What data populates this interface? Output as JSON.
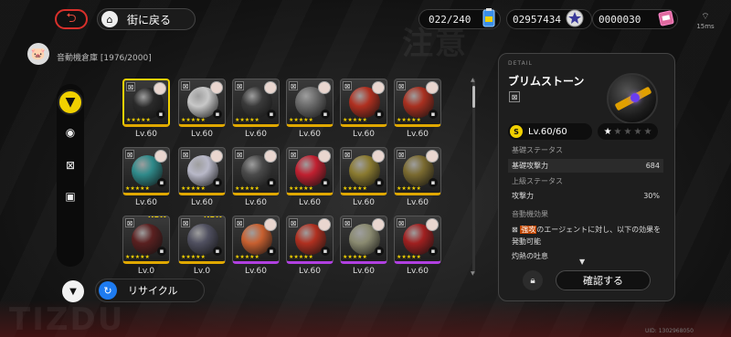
{
  "topbar": {
    "back_icon": "return-arrow-icon",
    "home_label": "街に戻る",
    "battery_count": "022/240",
    "dennies": "02957434",
    "polychrome": "0000030",
    "ping": "15ms"
  },
  "header": {
    "storage_label": "音動機倉庫 [1976/2000]"
  },
  "side_nav": {
    "items": [
      "bangboo-tab",
      "disc-tab",
      "module-tab",
      "lock-tab"
    ]
  },
  "grid": {
    "rows": [
      [
        {
          "level": "Lv.60",
          "rarity": "gold",
          "color": "#2a2a2a",
          "selected": true
        },
        {
          "level": "Lv.60",
          "rarity": "gold",
          "color": "#c8c8c8"
        },
        {
          "level": "Lv.60",
          "rarity": "gold",
          "color": "#3a3a3a"
        },
        {
          "level": "Lv.60",
          "rarity": "gold",
          "color": "#6a6a6a"
        },
        {
          "level": "Lv.60",
          "rarity": "gold",
          "color": "#b03020"
        },
        {
          "level": "Lv.60",
          "rarity": "gold",
          "color": "#a83020"
        }
      ],
      [
        {
          "level": "Lv.60",
          "rarity": "gold",
          "color": "#2f8a8a"
        },
        {
          "level": "Lv.60",
          "rarity": "gold",
          "color": "#b8b8c8"
        },
        {
          "level": "Lv.60",
          "rarity": "gold",
          "color": "#4a4a4a"
        },
        {
          "level": "Lv.60",
          "rarity": "gold",
          "color": "#c02030"
        },
        {
          "level": "Lv.60",
          "rarity": "gold",
          "color": "#8a7a30"
        },
        {
          "level": "Lv.60",
          "rarity": "gold",
          "color": "#7a6a30"
        }
      ],
      [
        {
          "level": "Lv.0",
          "rarity": "gold",
          "color": "#5a2020",
          "is_new": true
        },
        {
          "level": "Lv.0",
          "rarity": "gold",
          "color": "#505060",
          "is_new": true
        },
        {
          "level": "Lv.60",
          "rarity": "purple",
          "color": "#c86030"
        },
        {
          "level": "Lv.60",
          "rarity": "purple",
          "color": "#b03020"
        },
        {
          "level": "Lv.60",
          "rarity": "purple",
          "color": "#8a8a70"
        },
        {
          "level": "Lv.60",
          "rarity": "purple",
          "color": "#a02020"
        }
      ]
    ],
    "new_label": "NEW!"
  },
  "bottom": {
    "recycle_label": "リサイクル"
  },
  "detail": {
    "tag": "DETAIL",
    "name": "ブリムストーン",
    "level": "Lv.60/60",
    "base_status_label": "基礎ステータス",
    "base_stat_name": "基礎攻撃力",
    "base_stat_value": "684",
    "upper_status_label": "上級ステータス",
    "upper_stat_name": "攻撃力",
    "upper_stat_value": "30%",
    "effect_label": "音動機効果",
    "effect_highlight": "強攻",
    "effect_text": "のエージェントに対し、以下の効果を発動可能",
    "effect_sub": "灼熱の吐息",
    "confirm_label": "確認する"
  },
  "uid": "UID: 1302968050"
}
